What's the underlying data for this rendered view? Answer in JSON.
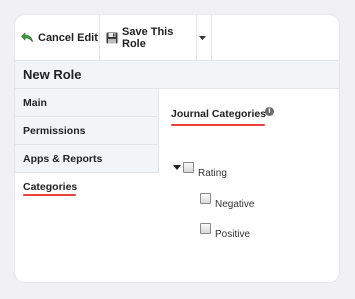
{
  "toolbar": {
    "cancel_label": "Cancel Edit",
    "save_label": "Save This Role"
  },
  "page": {
    "title": "New Role"
  },
  "sidenav": {
    "items": [
      {
        "label": "Main"
      },
      {
        "label": "Permissions"
      },
      {
        "label": "Apps & Reports"
      },
      {
        "label": "Categories",
        "active": true
      }
    ]
  },
  "section": {
    "title": "Journal Categories",
    "info_glyph": "i"
  },
  "tree": {
    "root": {
      "label": "Rating",
      "expanded": true
    },
    "children": [
      {
        "label": "Negative"
      },
      {
        "label": "Positive"
      }
    ]
  },
  "colors": {
    "accent_underline": "#e8413c",
    "panel_background": "#f3f4f6"
  }
}
